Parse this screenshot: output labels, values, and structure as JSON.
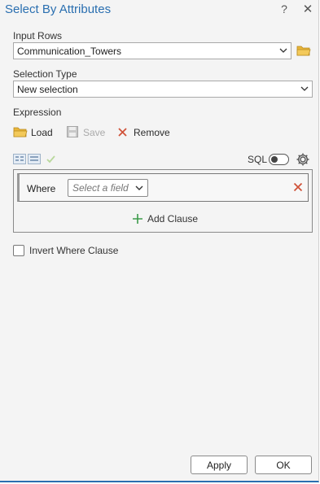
{
  "window": {
    "title": "Select By Attributes",
    "help_label": "?",
    "close_label": "✕"
  },
  "input_rows": {
    "label": "Input Rows",
    "value": "Communication_Towers"
  },
  "selection_type": {
    "label": "Selection Type",
    "value": "New selection"
  },
  "expression": {
    "label": "Expression",
    "load_label": "Load",
    "save_label": "Save",
    "remove_label": "Remove",
    "sql_label": "SQL",
    "sql_enabled": false
  },
  "clause": {
    "where_label": "Where",
    "field_placeholder": "Select a field",
    "add_clause_label": "Add Clause"
  },
  "invert": {
    "label": "Invert Where Clause",
    "checked": false
  },
  "footer": {
    "apply_label": "Apply",
    "ok_label": "OK"
  },
  "colors": {
    "title": "#2a6fb0",
    "folder": "#e8b53a",
    "remove": "#d0533a",
    "add": "#3c9b4a",
    "check": "#79b84a"
  }
}
